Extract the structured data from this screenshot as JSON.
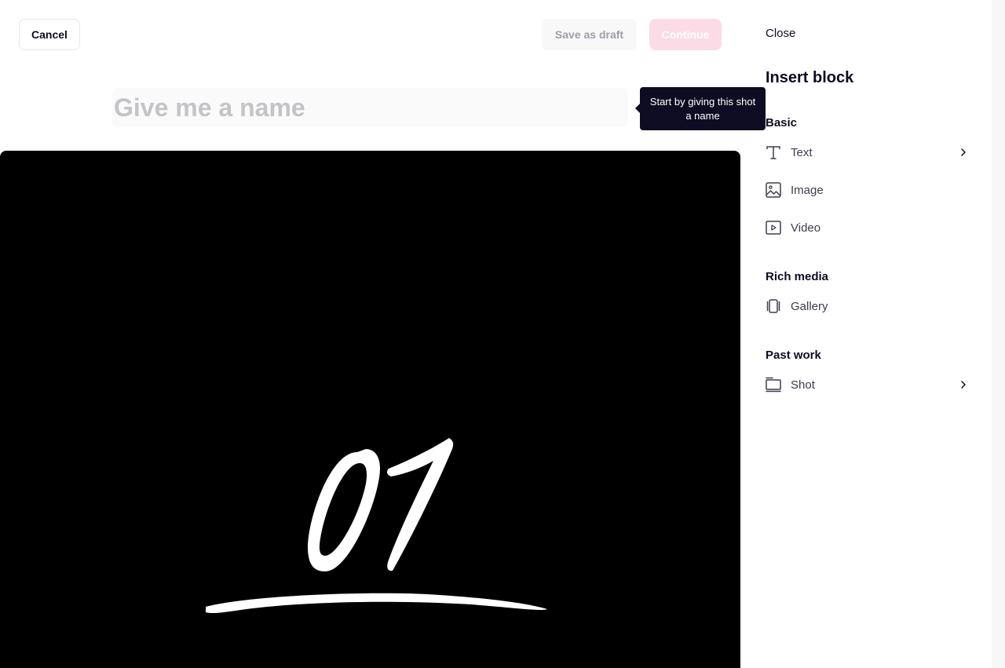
{
  "header": {
    "cancel_label": "Cancel",
    "save_draft_label": "Save as draft",
    "continue_label": "Continue"
  },
  "title_input": {
    "placeholder": "Give me a name",
    "value": ""
  },
  "tooltip": {
    "text": "Start by giving this shot a name"
  },
  "media": {
    "caption": "01"
  },
  "panel": {
    "close_label": "Close",
    "title": "Insert block",
    "sections": [
      {
        "label": "Basic",
        "items": [
          {
            "label": "Text",
            "icon": "text-icon",
            "has_submenu": true
          },
          {
            "label": "Image",
            "icon": "image-icon",
            "has_submenu": false
          },
          {
            "label": "Video",
            "icon": "video-icon",
            "has_submenu": false
          }
        ]
      },
      {
        "label": "Rich media",
        "items": [
          {
            "label": "Gallery",
            "icon": "gallery-icon",
            "has_submenu": false
          }
        ]
      },
      {
        "label": "Past work",
        "items": [
          {
            "label": "Shot",
            "icon": "shot-icon",
            "has_submenu": true
          }
        ]
      }
    ]
  },
  "colors": {
    "accent_disabled": "#fbdbe5",
    "text_primary": "#0d0c22",
    "tooltip_bg": "#0d0c22"
  }
}
